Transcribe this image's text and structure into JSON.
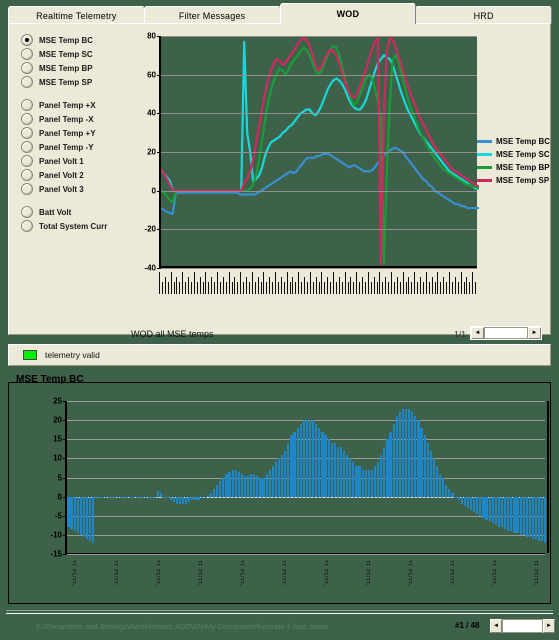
{
  "tabs": [
    {
      "label": "Realtime Telemetry",
      "active": false
    },
    {
      "label": "Filter Messages",
      "active": false
    },
    {
      "label": "WOD",
      "active": true
    },
    {
      "label": "HRD",
      "active": false
    }
  ],
  "sidebar": {
    "groups": [
      {
        "items": [
          {
            "label": "MSE Temp BC",
            "selected": true
          },
          {
            "label": "MSE Temp SC",
            "selected": false
          },
          {
            "label": "MSE Temp BP",
            "selected": false
          },
          {
            "label": "MSE Temp SP",
            "selected": false
          }
        ]
      },
      {
        "items": [
          {
            "label": "Panel Temp +X",
            "selected": false
          },
          {
            "label": "Panel Temp -X",
            "selected": false
          },
          {
            "label": "Panel Temp +Y",
            "selected": false
          },
          {
            "label": "Panel Temp -Y",
            "selected": false
          },
          {
            "label": "Panel Volt 1",
            "selected": false
          },
          {
            "label": "Panel Volt 2",
            "selected": false
          },
          {
            "label": "Panel Volt 3",
            "selected": false
          }
        ]
      },
      {
        "items": [
          {
            "label": "Batt Volt",
            "selected": false
          },
          {
            "label": "Total System Curr",
            "selected": false
          }
        ]
      }
    ]
  },
  "top_chart": {
    "caption": "WOD all MSE temps",
    "page": "1/1",
    "scroll_left_icon": "◄",
    "scroll_right_icon": "►"
  },
  "telemetry": {
    "status_label": "telemetry valid",
    "status_color": "#00ee00"
  },
  "bottom_chart": {
    "title": "MSE Temp BC"
  },
  "statusbar": {
    "path": "E:\\Documents and Settings\\Administrator.ADZMIN\\My Documents\\funcube-1.func.bebin",
    "counter": "#1 / 48",
    "scroll_left_icon": "◄",
    "scroll_right_icon": "►"
  },
  "chart_data": [
    {
      "type": "line",
      "title": "WOD all MSE temps",
      "xlabel": "",
      "ylabel": "",
      "ylim": [
        -40,
        80
      ],
      "yticks": [
        80,
        60,
        40,
        20,
        0,
        -20,
        -40
      ],
      "grid": true,
      "legend_position": "right",
      "background": "#3d6149",
      "series": [
        {
          "name": "MSE Temp BC",
          "color": "#3a8fd0",
          "values": [
            -9,
            -10,
            -11,
            -11.5,
            -12,
            -1,
            -1,
            -1,
            -1,
            -1,
            -1,
            -1,
            -1,
            -1,
            -1,
            -1,
            -1,
            -1,
            -1,
            -1,
            -1,
            -1,
            -1,
            -1,
            -1,
            -1,
            -1,
            -2,
            -2,
            -2,
            -2,
            -2,
            -2,
            -1,
            0,
            1,
            2,
            3,
            4,
            5,
            6,
            7,
            8,
            9,
            10,
            9,
            10,
            12,
            14,
            16,
            17,
            17,
            17,
            18,
            18,
            19,
            19,
            19,
            18,
            17,
            16,
            15,
            14,
            13,
            12,
            13,
            13,
            12,
            11,
            10,
            10,
            10,
            11,
            13,
            15,
            17,
            19,
            20,
            21,
            22,
            22,
            21,
            20,
            18,
            16,
            14,
            12,
            10,
            8,
            6,
            5,
            3,
            2,
            0,
            -1,
            -2,
            -3,
            -4,
            -5,
            -6,
            -7,
            -7,
            -8,
            -8,
            -9,
            -9,
            -9,
            -9,
            -9
          ]
        },
        {
          "name": "MSE Temp SC",
          "color": "#18d8dc",
          "values": [
            11,
            9,
            7,
            5,
            0,
            0,
            0,
            0,
            0,
            0,
            0,
            0,
            0,
            0,
            0,
            0,
            0,
            0,
            0,
            0,
            0,
            0,
            0,
            0,
            0,
            0,
            0,
            0,
            77,
            30,
            20,
            5,
            6,
            8,
            12,
            18,
            22,
            25,
            26,
            27,
            28,
            30,
            31,
            33,
            34,
            36,
            38,
            40,
            41,
            42,
            42,
            40,
            39,
            41,
            44,
            48,
            52,
            55,
            57,
            58,
            57,
            55,
            52,
            48,
            45,
            43,
            42,
            42,
            44,
            47,
            52,
            57,
            62,
            66,
            68,
            70,
            69,
            68,
            65,
            60,
            55,
            50,
            46,
            42,
            39,
            36,
            33,
            30,
            28,
            26,
            24,
            22,
            20,
            18,
            16,
            14,
            12,
            10,
            9,
            8,
            7,
            6,
            5,
            4,
            3,
            2,
            1,
            1
          ]
        },
        {
          "name": "MSE Temp BP",
          "color": "#1a9c3a",
          "values": [
            0,
            -1,
            -3,
            -5,
            -6,
            0,
            0,
            0,
            0,
            0,
            0,
            0,
            0,
            0,
            0,
            0,
            0,
            0,
            0,
            0,
            0,
            0,
            0,
            0,
            0,
            0,
            0,
            0,
            0,
            0,
            1,
            3,
            8,
            16,
            26,
            36,
            45,
            52,
            57,
            61,
            63,
            62,
            60,
            63,
            66,
            68,
            70,
            72,
            74,
            73,
            70,
            66,
            62,
            60,
            62,
            66,
            70,
            73,
            75,
            74,
            70,
            64,
            58,
            52,
            47,
            44,
            46,
            50,
            54,
            58,
            60,
            58,
            53,
            46,
            38,
            -38,
            10,
            45,
            68,
            70,
            66,
            60,
            54,
            48,
            43,
            39,
            35,
            31,
            28,
            25,
            22,
            19,
            17,
            15,
            13,
            11,
            10,
            9,
            8,
            7,
            6,
            5,
            4,
            3,
            3,
            2,
            2,
            1
          ]
        },
        {
          "name": "MSE Temp SP",
          "color": "#cf2960",
          "values": [
            11,
            9,
            6,
            3,
            0,
            0,
            0,
            0,
            0,
            0,
            0,
            0,
            0,
            0,
            0,
            0,
            0,
            0,
            0,
            0,
            0,
            0,
            0,
            0,
            0,
            0,
            0,
            0,
            4,
            6,
            10,
            16,
            24,
            33,
            42,
            50,
            57,
            62,
            66,
            68,
            67,
            65,
            66,
            69,
            71,
            73,
            76,
            78,
            79,
            78,
            75,
            70,
            65,
            62,
            64,
            68,
            71,
            73,
            72,
            70,
            66,
            61,
            56,
            52,
            49,
            48,
            50,
            54,
            58,
            63,
            68,
            73,
            77,
            79,
            -38,
            40,
            72,
            79,
            78,
            74,
            69,
            64,
            59,
            54,
            50,
            46,
            42,
            38,
            35,
            32,
            29,
            26,
            23,
            21,
            19,
            17,
            15,
            13,
            11,
            10,
            9,
            8,
            7,
            6,
            5,
            4,
            3,
            2
          ]
        }
      ]
    },
    {
      "type": "bar",
      "title": "MSE Temp BC",
      "xlabel": "",
      "ylabel": "",
      "ylim": [
        -15,
        25
      ],
      "yticks": [
        25,
        20,
        15,
        10,
        5,
        0,
        -5,
        -10,
        -15
      ],
      "grid": true,
      "bar_color": "#1f87c9",
      "values": [
        -8,
        -8.5,
        -9,
        -9.5,
        -10,
        -10.5,
        -11,
        -11.5,
        -12,
        0,
        0,
        0,
        0,
        0,
        0,
        0,
        0,
        0,
        0,
        0,
        0,
        0,
        0,
        0,
        0,
        0,
        0,
        0,
        0,
        1.5,
        1,
        0,
        0,
        -1,
        -1.5,
        -2,
        -2,
        -2,
        -2,
        -1.5,
        -1,
        -1,
        -1,
        0,
        0,
        0.5,
        1,
        2,
        3,
        4,
        5,
        6,
        6.5,
        7,
        7,
        6.5,
        6,
        5.5,
        5.5,
        6,
        6,
        5.5,
        5,
        5,
        6,
        7,
        8,
        9,
        10,
        11,
        12,
        14,
        16,
        17,
        18,
        19,
        20,
        20,
        20,
        20,
        19,
        18,
        17,
        16,
        15,
        14,
        14,
        13,
        13,
        12,
        11,
        10,
        9,
        8,
        8,
        7,
        7,
        7,
        7,
        8,
        9,
        11,
        13,
        15,
        17,
        19,
        21,
        22,
        23,
        23,
        23,
        22,
        21,
        20,
        18,
        16,
        14,
        12,
        10,
        8,
        6,
        5,
        3,
        2,
        1,
        0,
        -1,
        -2,
        -2.5,
        -3,
        -3.5,
        -4,
        -4.5,
        -5,
        -5.5,
        -6,
        -6.5,
        -7,
        -7.5,
        -8,
        -8,
        -8.5,
        -9,
        -9,
        -9.5,
        -9.5,
        -10,
        -10,
        -10.5,
        -10.5,
        -11,
        -11,
        -11.5,
        -11.5,
        -12
      ],
      "tick_labels": [
        "20/11/13 11:02",
        "20/11/13 11:04",
        "20/11/13 11:06",
        "20/11/13 11:08",
        "20/11/13 11:10",
        "20/11/13 11:12",
        "20/11/13 11:14",
        "20/11/13 11:16",
        "20/11/13 11:18",
        "20/11/13 11:20",
        "20/11/13 11:22",
        "20/11/13 11:24",
        "20/11/13 11:26",
        "20/11/13 11:28",
        "20/11/13 11:30",
        "20/11/13 11:32",
        "20/11/13 11:34",
        "20/11/13 11:36",
        "20/11/13 11:38",
        "20/11/13 11:40",
        "20/11/13 11:42",
        "20/11/13 11:44",
        "20/11/13 11:46",
        "20/11/13 11:48",
        "20/11/13 11:50",
        "20/11/13 11:52",
        "20/11/13 11:54",
        "20/11/13 11:56",
        "20/11/13 11:58",
        "20/11/13 12:00",
        "20/11/13 12:02",
        "20/11/13 12:04",
        "20/11/13 12:06",
        "20/11/13 12:08",
        "20/11/13 12:10",
        "20/11/13 12:12",
        "20/11/13 12:14",
        "20/11/13 12:16",
        "20/11/13 12:18",
        "20/11/13 12:20",
        "20/11/13 12:22",
        "20/11/13 12:24",
        "20/11/13 12:26",
        "20/11/13 12:28",
        "20/11/13 12:30",
        "20/11/13 12:32",
        "20/11/13 12:34",
        "20/11/13 12:36",
        "20/11/13 12:38",
        "20/11/13 12:40"
      ]
    }
  ]
}
